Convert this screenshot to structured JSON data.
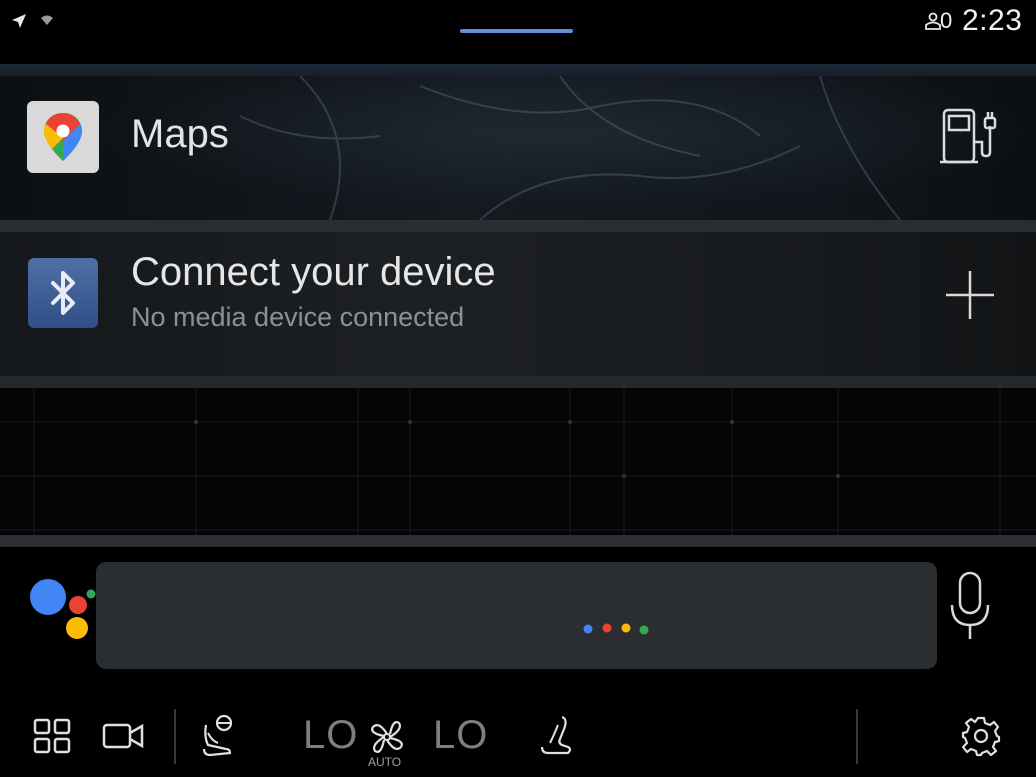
{
  "status_bar": {
    "icons": [
      "navigation-arrow-icon",
      "signal-icon",
      "user-icon"
    ],
    "profile_indicator": "0",
    "time": "2:23"
  },
  "maps_card": {
    "icon": "google-maps-icon",
    "label": "Maps",
    "action_icon": "ev-charging-station-icon"
  },
  "media_card": {
    "icon": "bluetooth-icon",
    "title": "Connect your device",
    "subtitle": "No media device connected",
    "action_icon": "plus-icon"
  },
  "assistant": {
    "logo": "google-assistant-icon",
    "dot_colors": [
      "#4285f4",
      "#ea4335",
      "#fbbc05",
      "#34a853"
    ],
    "mic_icon": "microphone-icon"
  },
  "climate_bar": {
    "temp_left": "LO",
    "temp_right": "LO",
    "fan_mode": "AUTO",
    "icons": [
      "apps-grid-icon",
      "camera-icon",
      "steering-wheel-heat-icon",
      "fan-icon",
      "seat-heat-icon",
      "gear-icon"
    ]
  },
  "colors": {
    "accent_handle": "#5f8fd6",
    "card_bg": "#1b1e21",
    "assistant_bar": "#2b2e31"
  }
}
